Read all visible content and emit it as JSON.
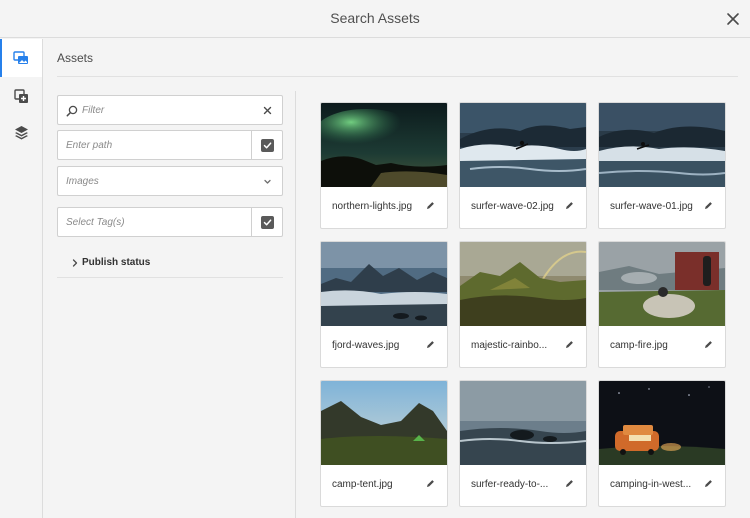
{
  "dialog": {
    "title": "Search Assets",
    "close_icon": "close-icon"
  },
  "rail": {
    "items": [
      {
        "icon": "images-icon",
        "active": true
      },
      {
        "icon": "copy-add-icon",
        "active": false
      },
      {
        "icon": "layers-icon",
        "active": false
      }
    ]
  },
  "panel": {
    "heading": "Assets",
    "filter": {
      "placeholder": "Filter",
      "value": ""
    },
    "path": {
      "placeholder": "Enter path",
      "value": ""
    },
    "type_select": {
      "selected": "Images"
    },
    "tags": {
      "placeholder": "Select Tag(s)",
      "value": ""
    },
    "publish_status": {
      "label": "Publish status"
    }
  },
  "assets": [
    {
      "name": "northern-lights.jpg"
    },
    {
      "name": "surfer-wave-02.jpg"
    },
    {
      "name": "surfer-wave-01.jpg"
    },
    {
      "name": "fjord-waves.jpg"
    },
    {
      "name": "majestic-rainbo..."
    },
    {
      "name": "camp-fire.jpg"
    },
    {
      "name": "camp-tent.jpg"
    },
    {
      "name": "surfer-ready-to-..."
    },
    {
      "name": "camping-in-west..."
    }
  ],
  "colors": {
    "accent": "#2680eb",
    "icon": "#4b4b4b"
  }
}
